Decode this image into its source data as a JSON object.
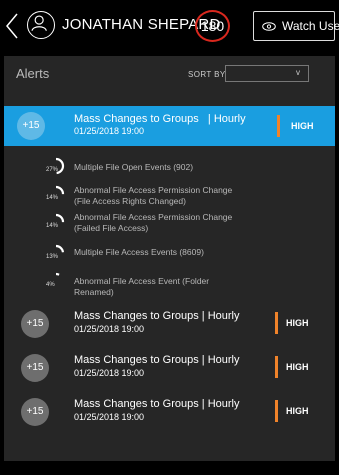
{
  "header": {
    "user_name": "JONATHAN SHEPARD",
    "score": "180",
    "watch_label": "Watch User"
  },
  "alerts_panel": {
    "title": "Alerts",
    "sort_label": "SORT BY",
    "sort_value": "",
    "sort_chevron": "v"
  },
  "alerts": [
    {
      "count": "+15",
      "title": "Mass Changes to Groups",
      "separator": "|",
      "frequency": "Hourly",
      "date": "01/25/2018 19:00",
      "severity": "HIGH",
      "selected": true
    },
    {
      "count": "+15",
      "title": "Mass Changes to Groups",
      "separator": "|",
      "frequency": "Hourly",
      "date": "01/25/2018 19:00",
      "severity": "HIGH",
      "selected": false
    },
    {
      "count": "+15",
      "title": "Mass Changes to Groups",
      "separator": "|",
      "frequency": "Hourly",
      "date": "01/25/2018 19:00",
      "severity": "HIGH",
      "selected": false
    },
    {
      "count": "+15",
      "title": "Mass Changes to Groups",
      "separator": "|",
      "frequency": "Hourly",
      "date": "01/25/2018 19:00",
      "severity": "HIGH",
      "selected": false
    }
  ],
  "sub_events": [
    {
      "pct": "27%",
      "fraction": 0.27,
      "text": "Multiple File Open Events (902)"
    },
    {
      "pct": "14%",
      "fraction": 0.14,
      "text": "Abnormal File Access Permission Change (File Access Rights Changed)"
    },
    {
      "pct": "14%",
      "fraction": 0.14,
      "text": "Abnormal File Access Permission Change (Failed File Access)"
    },
    {
      "pct": "13%",
      "fraction": 0.13,
      "text": "Multiple File Access Events (8609)"
    },
    {
      "pct": "4%",
      "fraction": 0.04,
      "text": "Abnormal File Access Event (Folder Renamed)"
    }
  ],
  "colors": {
    "selected_bg": "#1a9ee0",
    "severity_high": "#f0832a",
    "score_ring": "#d9281e",
    "panel_bg": "#262626"
  }
}
